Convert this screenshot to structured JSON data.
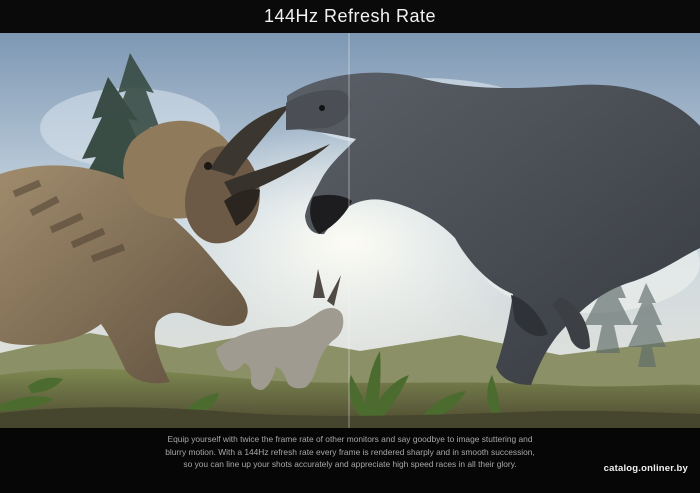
{
  "header": {
    "title": "144Hz Refresh Rate"
  },
  "banner": {
    "left_label": "",
    "right_label": ""
  },
  "caption": {
    "text": "Equip yourself with twice the frame rate of other monitors and say goodbye to image stuttering and blurry motion. With a 144Hz refresh rate every frame is rendered sharply and in smooth succession, so you can line up your shots accurately and appreciate high speed races in all their glory."
  },
  "watermark": {
    "text": "catalog.onliner.by"
  },
  "colors": {
    "background": "#060606",
    "title": "#f2f2f2",
    "caption": "#a8a8a8"
  }
}
